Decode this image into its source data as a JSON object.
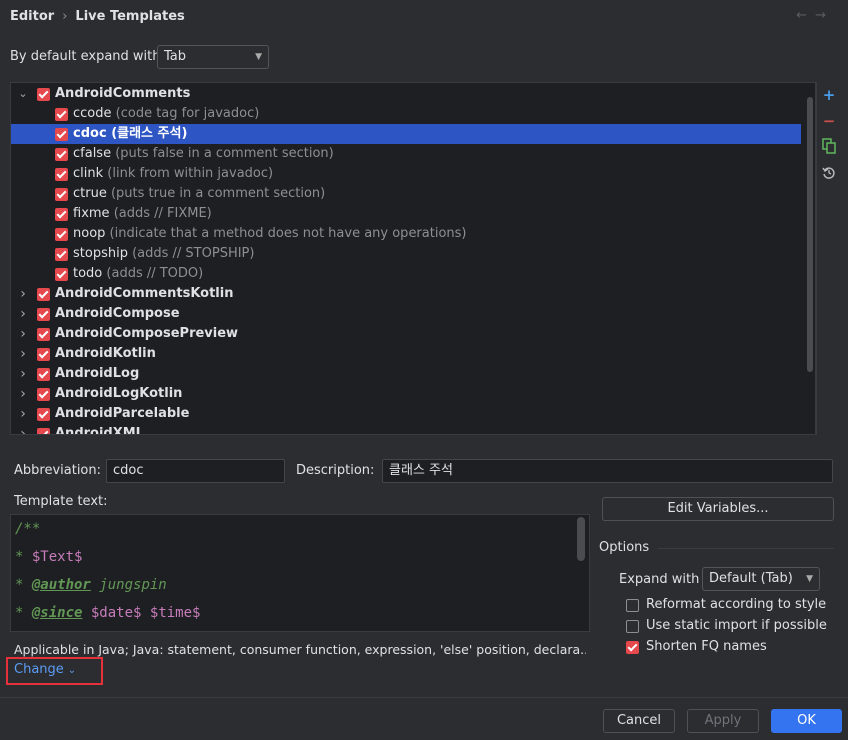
{
  "breadcrumb": {
    "parent": "Editor",
    "current": "Live Templates"
  },
  "expand_default": {
    "label": "By default expand with",
    "value": "Tab"
  },
  "tree": {
    "groups_expanded": {
      "name": "AndroidComments",
      "items": [
        {
          "abbr": "ccode",
          "desc": "(code tag for javadoc)"
        },
        {
          "abbr": "cdoc",
          "desc": "(클래스 주석)",
          "selected": true
        },
        {
          "abbr": "cfalse",
          "desc": "(puts false in a comment section)"
        },
        {
          "abbr": "clink",
          "desc": "(link from within javadoc)"
        },
        {
          "abbr": "ctrue",
          "desc": "(puts true in a comment section)"
        },
        {
          "abbr": "fixme",
          "desc": "(adds // FIXME)"
        },
        {
          "abbr": "noop",
          "desc": "(indicate that a method does not have any operations)"
        },
        {
          "abbr": "stopship",
          "desc": "(adds // STOPSHIP)"
        },
        {
          "abbr": "todo",
          "desc": "(adds // TODO)"
        }
      ]
    },
    "collapsed_groups": [
      "AndroidCommentsKotlin",
      "AndroidCompose",
      "AndroidComposePreview",
      "AndroidKotlin",
      "AndroidLog",
      "AndroidLogKotlin",
      "AndroidParcelable",
      "AndroidXML"
    ]
  },
  "side_tools": {
    "add": "+",
    "remove": "−",
    "copy_icon": "copy-icon",
    "restore_icon": "restore-icon"
  },
  "abbreviation": {
    "label": "Abbreviation:",
    "value": "cdoc"
  },
  "description": {
    "label": "Description:",
    "value": "클래스 주석"
  },
  "template_text": {
    "label": "Template text:",
    "lines": {
      "l1": "/**",
      "l2_star": "* ",
      "l2_var": "$Text$",
      "l3_star": "* ",
      "l3_tag": "@author",
      "l3_rest": " jungspin",
      "l4_star": "* ",
      "l4_tag": "@since",
      "l4_sp": " ",
      "l4_var1": "$date$",
      "l4_sp2": " ",
      "l4_var2": "$time$"
    }
  },
  "edit_variables": "Edit Variables...",
  "options": {
    "title": "Options",
    "expand_label": "Expand with",
    "expand_value": "Default (Tab)",
    "reformat": {
      "label": "Reformat according to style",
      "checked": false
    },
    "static_import": {
      "label": "Use static import if possible",
      "checked": false
    },
    "shorten_fq": {
      "label": "Shorten FQ names",
      "checked": true
    }
  },
  "applicable": "Applicable in Java; Java: statement, consumer function, expression, 'else' position, declara...",
  "change_link": "Change",
  "buttons": {
    "cancel": "Cancel",
    "apply": "Apply",
    "ok": "OK"
  },
  "colors": {
    "accent": "#3574f0",
    "selection": "#2e55c4",
    "checkbox": "#e5484d",
    "highlight": "#e5323a"
  }
}
